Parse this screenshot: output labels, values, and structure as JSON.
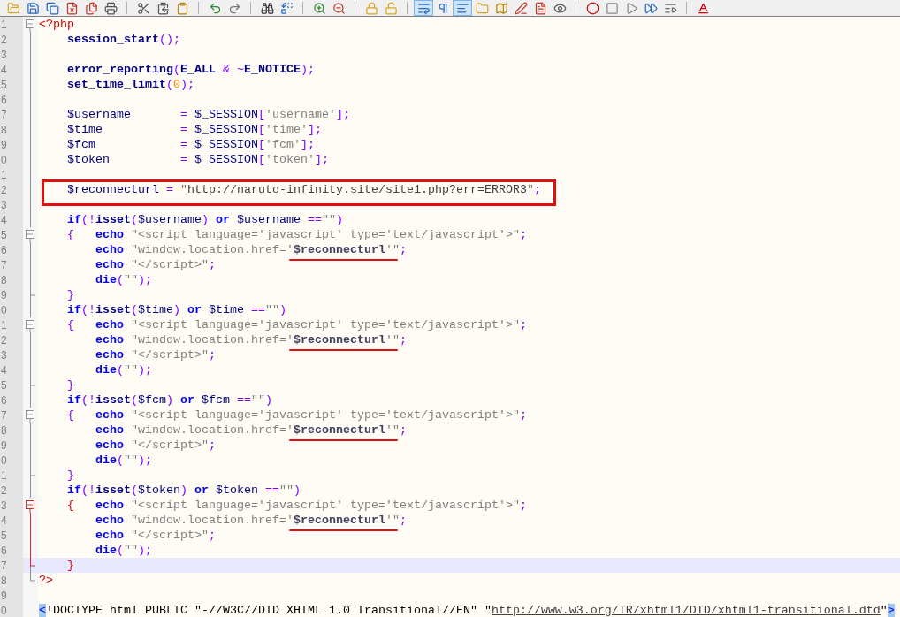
{
  "toolbar": [
    {
      "kind": "button",
      "pressed": false
    },
    {
      "kind": "button",
      "pressed": false
    },
    {
      "kind": "button",
      "pressed": false
    },
    {
      "kind": "button",
      "pressed": false
    },
    {
      "kind": "button",
      "pressed": false
    },
    {
      "kind": "button",
      "pressed": false
    },
    {
      "kind": "separator"
    },
    {
      "kind": "button",
      "pressed": false
    },
    {
      "kind": "button",
      "pressed": false
    },
    {
      "kind": "button",
      "pressed": false
    },
    {
      "kind": "separator"
    },
    {
      "kind": "button",
      "pressed": false
    },
    {
      "kind": "button",
      "pressed": false
    },
    {
      "kind": "separator"
    },
    {
      "kind": "button",
      "pressed": false
    },
    {
      "kind": "button",
      "pressed": false
    },
    {
      "kind": "separator"
    },
    {
      "kind": "button",
      "pressed": false
    },
    {
      "kind": "button",
      "pressed": false
    },
    {
      "kind": "separator"
    },
    {
      "kind": "button",
      "pressed": false
    },
    {
      "kind": "button",
      "pressed": false
    },
    {
      "kind": "separator"
    },
    {
      "kind": "button",
      "pressed": true
    },
    {
      "kind": "button",
      "pressed": false
    },
    {
      "kind": "button",
      "pressed": true
    },
    {
      "kind": "button",
      "pressed": false
    },
    {
      "kind": "button",
      "pressed": false
    },
    {
      "kind": "button",
      "pressed": false
    },
    {
      "kind": "button",
      "pressed": false
    },
    {
      "kind": "button",
      "pressed": false
    },
    {
      "kind": "separator"
    },
    {
      "kind": "button",
      "pressed": false
    },
    {
      "kind": "button",
      "pressed": false
    },
    {
      "kind": "button",
      "pressed": false
    },
    {
      "kind": "button",
      "pressed": false
    },
    {
      "kind": "button",
      "pressed": false
    },
    {
      "kind": "separator"
    },
    {
      "kind": "button",
      "pressed": false
    }
  ],
  "lines": [
    {
      "number": "1",
      "fold": {
        "kind": "start",
        "active": false
      },
      "current": false,
      "tokens": [
        {
          "kind": "tag",
          "text": "<?php"
        }
      ]
    },
    {
      "number": "2",
      "fold": {
        "kind": "mid",
        "active": false
      },
      "current": false,
      "tokens": [
        {
          "kind": "fn",
          "text": "    session_start"
        },
        {
          "kind": "op",
          "text": "();"
        }
      ]
    },
    {
      "number": "3",
      "fold": {
        "kind": "mid",
        "active": false
      },
      "current": false
    },
    {
      "number": "4",
      "fold": {
        "kind": "mid",
        "active": false
      },
      "current": false,
      "tokens": [
        {
          "kind": "fn",
          "text": "    error_reporting"
        },
        {
          "kind": "op",
          "text": "("
        },
        {
          "kind": "fn",
          "text": "E_ALL"
        },
        {
          "kind": "op",
          "text": " & ~"
        },
        {
          "kind": "fn",
          "text": "E_NOTICE"
        },
        {
          "kind": "op",
          "text": ");"
        }
      ]
    },
    {
      "number": "5",
      "fold": {
        "kind": "mid",
        "active": false
      },
      "current": false,
      "tokens": [
        {
          "kind": "fn",
          "text": "    set_time_limit"
        },
        {
          "kind": "op",
          "text": "("
        },
        {
          "kind": "num",
          "text": "0"
        },
        {
          "kind": "op",
          "text": ");"
        }
      ]
    },
    {
      "number": "6",
      "fold": {
        "kind": "mid",
        "active": false
      },
      "current": false
    },
    {
      "number": "7",
      "fold": {
        "kind": "mid",
        "active": false
      },
      "current": false,
      "tokens": [
        {
          "kind": "var",
          "text": "    $username"
        },
        {
          "kind": "op",
          "text": "       ="
        },
        {
          "kind": "var",
          "text": " $_SESSION"
        },
        {
          "kind": "op",
          "text": "["
        },
        {
          "kind": "str",
          "text": "'username'"
        },
        {
          "kind": "op",
          "text": "];"
        }
      ]
    },
    {
      "number": "8",
      "fold": {
        "kind": "mid",
        "active": false
      },
      "current": false,
      "tokens": [
        {
          "kind": "var",
          "text": "    $time"
        },
        {
          "kind": "op",
          "text": "           ="
        },
        {
          "kind": "var",
          "text": " $_SESSION"
        },
        {
          "kind": "op",
          "text": "["
        },
        {
          "kind": "str",
          "text": "'time'"
        },
        {
          "kind": "op",
          "text": "];"
        }
      ]
    },
    {
      "number": "9",
      "fold": {
        "kind": "mid",
        "active": false
      },
      "current": false,
      "tokens": [
        {
          "kind": "var",
          "text": "    $fcm"
        },
        {
          "kind": "op",
          "text": "            ="
        },
        {
          "kind": "var",
          "text": " $_SESSION"
        },
        {
          "kind": "op",
          "text": "["
        },
        {
          "kind": "str",
          "text": "'fcm'"
        },
        {
          "kind": "op",
          "text": "];"
        }
      ]
    },
    {
      "number": "0",
      "fold": {
        "kind": "mid",
        "active": false
      },
      "current": false,
      "tokens": [
        {
          "kind": "var",
          "text": "    $token"
        },
        {
          "kind": "op",
          "text": "          ="
        },
        {
          "kind": "var",
          "text": " $_SESSION"
        },
        {
          "kind": "op",
          "text": "["
        },
        {
          "kind": "str",
          "text": "'token'"
        },
        {
          "kind": "op",
          "text": "];"
        }
      ]
    },
    {
      "number": "1",
      "fold": {
        "kind": "mid",
        "active": false
      },
      "current": false
    },
    {
      "number": "2",
      "fold": {
        "kind": "mid",
        "active": false
      },
      "current": false,
      "annotation": {
        "kind": "box"
      },
      "tokens": [
        {
          "kind": "var",
          "text": "    $reconnecturl"
        },
        {
          "kind": "op",
          "text": " ="
        },
        {
          "kind": "str",
          "text": " \""
        },
        {
          "kind": "url",
          "text": "http://naruto-infinity.site/site1.php?err=ERROR3"
        },
        {
          "kind": "str",
          "text": "\""
        },
        {
          "kind": "op",
          "text": ";"
        }
      ]
    },
    {
      "number": "3",
      "fold": {
        "kind": "mid",
        "active": false
      },
      "current": false
    },
    {
      "number": "4",
      "fold": {
        "kind": "mid",
        "active": false
      },
      "current": false,
      "tokens": [
        {
          "kind": "kw",
          "text": "    if"
        },
        {
          "kind": "op",
          "text": "(!"
        },
        {
          "kind": "fn",
          "text": "isset"
        },
        {
          "kind": "op",
          "text": "("
        },
        {
          "kind": "var",
          "text": "$username"
        },
        {
          "kind": "op",
          "text": ")"
        },
        {
          "kind": "kw",
          "text": " or"
        },
        {
          "kind": "var",
          "text": " $username"
        },
        {
          "kind": "op",
          "text": " =="
        },
        {
          "kind": "str",
          "text": "\"\""
        },
        {
          "kind": "op",
          "text": ")"
        }
      ]
    },
    {
      "number": "5",
      "fold": {
        "kind": "start",
        "active": false
      },
      "current": false,
      "tokens": [
        {
          "kind": "op",
          "text": "    {"
        },
        {
          "kind": "kw",
          "text": "   echo"
        },
        {
          "kind": "str",
          "text": " \"<script language='javascript' type='text/javascript'>\""
        },
        {
          "kind": "op",
          "text": ";"
        }
      ]
    },
    {
      "number": "6",
      "fold": {
        "kind": "mid",
        "active": false
      },
      "current": false,
      "annotation": {
        "kind": "underline"
      },
      "tokens": [
        {
          "kind": "kw",
          "text": "        echo"
        },
        {
          "kind": "str",
          "text": " \"window.location.href='"
        },
        {
          "kind": "strvar",
          "text": "$reconnecturl"
        },
        {
          "kind": "str",
          "text": "'\""
        },
        {
          "kind": "op",
          "text": ";"
        }
      ]
    },
    {
      "number": "7",
      "fold": {
        "kind": "mid",
        "active": false
      },
      "current": false,
      "tokens": [
        {
          "kind": "kw",
          "text": "        echo"
        },
        {
          "kind": "str",
          "text": " \"</script>\""
        },
        {
          "kind": "op",
          "text": ";"
        }
      ]
    },
    {
      "number": "8",
      "fold": {
        "kind": "mid",
        "active": false
      },
      "current": false,
      "tokens": [
        {
          "kind": "kw",
          "text": "        die"
        },
        {
          "kind": "op",
          "text": "("
        },
        {
          "kind": "str",
          "text": "\"\""
        },
        {
          "kind": "op",
          "text": ");"
        }
      ]
    },
    {
      "number": "9",
      "fold": {
        "kind": "end",
        "active": false
      },
      "current": false,
      "tokens": [
        {
          "kind": "op",
          "text": "    }"
        }
      ]
    },
    {
      "number": "0",
      "fold": {
        "kind": "mid",
        "active": false
      },
      "current": false,
      "tokens": [
        {
          "kind": "kw",
          "text": "    if"
        },
        {
          "kind": "op",
          "text": "(!"
        },
        {
          "kind": "fn",
          "text": "isset"
        },
        {
          "kind": "op",
          "text": "("
        },
        {
          "kind": "var",
          "text": "$time"
        },
        {
          "kind": "op",
          "text": ")"
        },
        {
          "kind": "kw",
          "text": " or"
        },
        {
          "kind": "var",
          "text": " $time"
        },
        {
          "kind": "op",
          "text": " =="
        },
        {
          "kind": "str",
          "text": "\"\""
        },
        {
          "kind": "op",
          "text": ")"
        }
      ]
    },
    {
      "number": "1",
      "fold": {
        "kind": "start",
        "active": false
      },
      "current": false,
      "tokens": [
        {
          "kind": "op",
          "text": "    {"
        },
        {
          "kind": "kw",
          "text": "   echo"
        },
        {
          "kind": "str",
          "text": " \"<script language='javascript' type='text/javascript'>\""
        },
        {
          "kind": "op",
          "text": ";"
        }
      ]
    },
    {
      "number": "2",
      "fold": {
        "kind": "mid",
        "active": false
      },
      "current": false,
      "annotation": {
        "kind": "underline"
      },
      "tokens": [
        {
          "kind": "kw",
          "text": "        echo"
        },
        {
          "kind": "str",
          "text": " \"window.location.href='"
        },
        {
          "kind": "strvar",
          "text": "$reconnecturl"
        },
        {
          "kind": "str",
          "text": "'\""
        },
        {
          "kind": "op",
          "text": ";"
        }
      ]
    },
    {
      "number": "3",
      "fold": {
        "kind": "mid",
        "active": false
      },
      "current": false,
      "tokens": [
        {
          "kind": "kw",
          "text": "        echo"
        },
        {
          "kind": "str",
          "text": " \"</script>\""
        },
        {
          "kind": "op",
          "text": ";"
        }
      ]
    },
    {
      "number": "4",
      "fold": {
        "kind": "mid",
        "active": false
      },
      "current": false,
      "tokens": [
        {
          "kind": "kw",
          "text": "        die"
        },
        {
          "kind": "op",
          "text": "("
        },
        {
          "kind": "str",
          "text": "\"\""
        },
        {
          "kind": "op",
          "text": ");"
        }
      ]
    },
    {
      "number": "5",
      "fold": {
        "kind": "end",
        "active": false
      },
      "current": false,
      "tokens": [
        {
          "kind": "op",
          "text": "    }"
        }
      ]
    },
    {
      "number": "6",
      "fold": {
        "kind": "mid",
        "active": false
      },
      "current": false,
      "tokens": [
        {
          "kind": "kw",
          "text": "    if"
        },
        {
          "kind": "op",
          "text": "(!"
        },
        {
          "kind": "fn",
          "text": "isset"
        },
        {
          "kind": "op",
          "text": "("
        },
        {
          "kind": "var",
          "text": "$fcm"
        },
        {
          "kind": "op",
          "text": ")"
        },
        {
          "kind": "kw",
          "text": " or"
        },
        {
          "kind": "var",
          "text": " $fcm"
        },
        {
          "kind": "op",
          "text": " =="
        },
        {
          "kind": "str",
          "text": "\"\""
        },
        {
          "kind": "op",
          "text": ")"
        }
      ]
    },
    {
      "number": "7",
      "fold": {
        "kind": "start",
        "active": false
      },
      "current": false,
      "tokens": [
        {
          "kind": "op",
          "text": "    {"
        },
        {
          "kind": "kw",
          "text": "   echo"
        },
        {
          "kind": "str",
          "text": " \"<script language='javascript' type='text/javascript'>\""
        },
        {
          "kind": "op",
          "text": ";"
        }
      ]
    },
    {
      "number": "8",
      "fold": {
        "kind": "mid",
        "active": false
      },
      "current": false,
      "annotation": {
        "kind": "underline"
      },
      "tokens": [
        {
          "kind": "kw",
          "text": "        echo"
        },
        {
          "kind": "str",
          "text": " \"window.location.href='"
        },
        {
          "kind": "strvar",
          "text": "$reconnecturl"
        },
        {
          "kind": "str",
          "text": "'\""
        },
        {
          "kind": "op",
          "text": ";"
        }
      ]
    },
    {
      "number": "9",
      "fold": {
        "kind": "mid",
        "active": false
      },
      "current": false,
      "tokens": [
        {
          "kind": "kw",
          "text": "        echo"
        },
        {
          "kind": "str",
          "text": " \"</script>\""
        },
        {
          "kind": "op",
          "text": ";"
        }
      ]
    },
    {
      "number": "0",
      "fold": {
        "kind": "mid",
        "active": false
      },
      "current": false,
      "tokens": [
        {
          "kind": "kw",
          "text": "        die"
        },
        {
          "kind": "op",
          "text": "("
        },
        {
          "kind": "str",
          "text": "\"\""
        },
        {
          "kind": "op",
          "text": ");"
        }
      ]
    },
    {
      "number": "1",
      "fold": {
        "kind": "end",
        "active": false
      },
      "current": false,
      "tokens": [
        {
          "kind": "op",
          "text": "    }"
        }
      ]
    },
    {
      "number": "2",
      "fold": {
        "kind": "mid",
        "active": false
      },
      "current": false,
      "tokens": [
        {
          "kind": "kw",
          "text": "    if"
        },
        {
          "kind": "op",
          "text": "(!"
        },
        {
          "kind": "fn",
          "text": "isset"
        },
        {
          "kind": "op",
          "text": "("
        },
        {
          "kind": "var",
          "text": "$token"
        },
        {
          "kind": "op",
          "text": ")"
        },
        {
          "kind": "kw",
          "text": " or"
        },
        {
          "kind": "var",
          "text": " $token"
        },
        {
          "kind": "op",
          "text": " =="
        },
        {
          "kind": "str",
          "text": "\"\""
        },
        {
          "kind": "op",
          "text": ")"
        }
      ]
    },
    {
      "number": "3",
      "fold": {
        "kind": "start",
        "active": true
      },
      "current": false,
      "tokens": [
        {
          "kind": "brace",
          "text": "    {"
        },
        {
          "kind": "kw",
          "text": "   echo"
        },
        {
          "kind": "str",
          "text": " \"<script language='javascript' type='text/javascript'>\""
        },
        {
          "kind": "op",
          "text": ";"
        }
      ]
    },
    {
      "number": "4",
      "fold": {
        "kind": "mid",
        "active": true
      },
      "current": false,
      "annotation": {
        "kind": "underline"
      },
      "tokens": [
        {
          "kind": "kw",
          "text": "        echo"
        },
        {
          "kind": "str",
          "text": " \"window.location.href='"
        },
        {
          "kind": "strvar",
          "text": "$reconnecturl"
        },
        {
          "kind": "str",
          "text": "'\""
        },
        {
          "kind": "op",
          "text": ";"
        }
      ]
    },
    {
      "number": "5",
      "fold": {
        "kind": "mid",
        "active": true
      },
      "current": false,
      "tokens": [
        {
          "kind": "kw",
          "text": "        echo"
        },
        {
          "kind": "str",
          "text": " \"</script>\""
        },
        {
          "kind": "op",
          "text": ";"
        }
      ]
    },
    {
      "number": "6",
      "fold": {
        "kind": "mid",
        "active": true
      },
      "current": false,
      "tokens": [
        {
          "kind": "kw",
          "text": "        die"
        },
        {
          "kind": "op",
          "text": "("
        },
        {
          "kind": "str",
          "text": "\"\""
        },
        {
          "kind": "op",
          "text": ");"
        }
      ]
    },
    {
      "number": "7",
      "fold": {
        "kind": "end",
        "active": true
      },
      "current": true,
      "tokens": [
        {
          "kind": "brace",
          "text": "    }"
        }
      ]
    },
    {
      "number": "8",
      "fold": {
        "kind": "last",
        "active": false
      },
      "current": false,
      "tokens": [
        {
          "kind": "tag",
          "text": "?>"
        }
      ]
    },
    {
      "number": "9",
      "current": false
    },
    {
      "number": "0",
      "current": false,
      "tokens": [
        {
          "kind": "match",
          "text": "<"
        },
        {
          "kind": "html",
          "text": "!DOCTYPE html PUBLIC \"-//W3C//DTD XHTML 1.0 Transitional//EN\" \""
        },
        {
          "kind": "url",
          "text": "http://www.w3.org/TR/xhtml1/DTD/xhtml1-transitional.dtd"
        },
        {
          "kind": "html",
          "text": "\""
        },
        {
          "kind": "match",
          "text": ">"
        }
      ]
    }
  ]
}
